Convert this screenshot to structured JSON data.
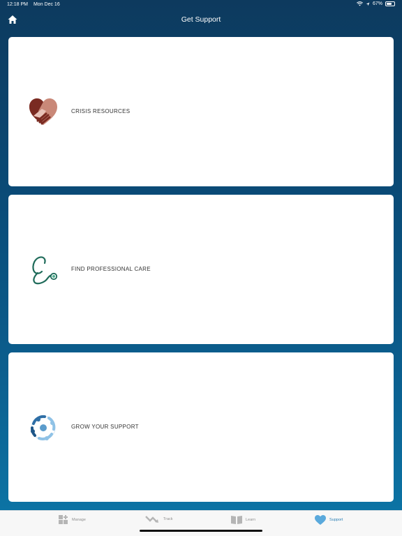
{
  "status_bar": {
    "time": "12:18 PM",
    "date": "Mon Dec 16",
    "battery_percent": "67%",
    "battery_level": 0.67,
    "icons": [
      "wifi-icon",
      "location-arrow-icon",
      "battery-icon"
    ]
  },
  "nav": {
    "title": "Get Support",
    "home_icon": "home-icon"
  },
  "cards": [
    {
      "label": "CRISIS RESOURCES",
      "icon": "heart-hands-icon"
    },
    {
      "label": "FIND PROFESSIONAL CARE",
      "icon": "stethoscope-icon"
    },
    {
      "label": "GROW YOUR SUPPORT",
      "icon": "community-circle-icon"
    }
  ],
  "tabs": [
    {
      "label": "Manage",
      "icon": "manage-grid-icon",
      "active": false
    },
    {
      "label": "Track",
      "icon": "track-trend-icon",
      "active": false
    },
    {
      "label": "Learn",
      "icon": "book-icon",
      "active": false
    },
    {
      "label": "Support",
      "icon": "heart-icon",
      "active": true
    }
  ],
  "colors": {
    "accent": "#2a7fb5",
    "background_top": "#0d3a5e",
    "background_bottom": "#0c77a8"
  }
}
